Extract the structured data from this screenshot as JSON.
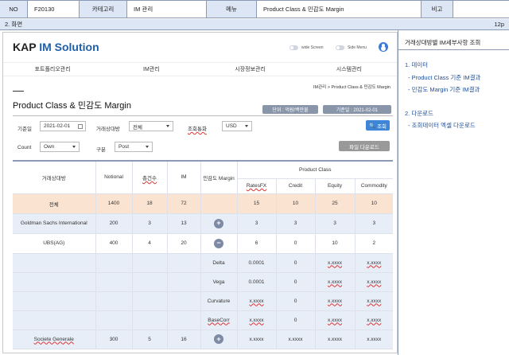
{
  "spec": {
    "no_label": "NO",
    "no_value": "F20130",
    "category_label": "카테고리",
    "category_value": "IM 관리",
    "menu_label": "메뉴",
    "menu_value": "Product Class & 민감도 Margin",
    "note_label": "비고",
    "note_value": ""
  },
  "section": {
    "title": "2. 화면",
    "page": "12p"
  },
  "app": {
    "logo_main": "KAP",
    "logo_accent": "IM Solution",
    "wide_screen_label": "wide Screen",
    "side_menu_label": "Side Menu",
    "nav": [
      "포트폴리오관리",
      "IM관리",
      "시장정보관리",
      "시스템관리"
    ],
    "breadcrumb": "IM관리 > Product Class & 민감도 Margin",
    "page_title": "Product Class & 민감도 Margin",
    "unit_pill": "단위 : 억원/백만불",
    "date_pill": "기준일 : 2021-02-01"
  },
  "filters": {
    "date_label": "기준일",
    "date_value": "2021-02-01",
    "counterparty_label": "거래상대방",
    "counterparty_value": "전체",
    "currency_label": "조회통화",
    "currency_value": "USD",
    "search_button": "조회",
    "count_label": "Count",
    "count_value": "Own",
    "type_label": "구분",
    "type_value": "Post",
    "download_button": "파일 다운로드"
  },
  "table": {
    "headers": {
      "counterparty": "거래상대방",
      "notional": "Notional",
      "count": "총건수",
      "im": "IM",
      "sensitivity_margin": "민감도 Margin",
      "product_class": "Product Class",
      "rates_fx": "RatesFX",
      "credit": "Credit",
      "equity": "Equity",
      "commodity": "Commodity"
    },
    "rows": [
      {
        "name": "전체",
        "notional": "1400",
        "count": "18",
        "im": "72",
        "sens": "",
        "rates_fx": "15",
        "credit": "10",
        "equity": "25",
        "commodity": "10"
      },
      {
        "name": "Goldman Sachs International",
        "notional": "200",
        "count": "3",
        "im": "13",
        "sens": "+",
        "rates_fx": "3",
        "credit": "3",
        "equity": "3",
        "commodity": "3"
      },
      {
        "name": "UBS(AG)",
        "notional": "400",
        "count": "4",
        "im": "20",
        "sens": "−",
        "rates_fx": "6",
        "credit": "0",
        "equity": "10",
        "commodity": "2"
      },
      {
        "name": "",
        "notional": "",
        "count": "",
        "im": "",
        "sens": "Delta",
        "rates_fx": "0.0001",
        "credit": "0",
        "equity": "x.xxxx",
        "commodity": "x.xxxx"
      },
      {
        "name": "",
        "notional": "",
        "count": "",
        "im": "",
        "sens": "Vega",
        "rates_fx": "0.0001",
        "credit": "0",
        "equity": "x.xxxx",
        "commodity": "x.xxxx"
      },
      {
        "name": "",
        "notional": "",
        "count": "",
        "im": "",
        "sens": "Curvature",
        "rates_fx": "x.xxxx",
        "credit": "0",
        "equity": "x.xxxx",
        "commodity": "x.xxxx"
      },
      {
        "name": "",
        "notional": "",
        "count": "",
        "im": "",
        "sens": "BaseCorr",
        "rates_fx": "x.xxxx",
        "credit": "0",
        "equity": "x.xxxx",
        "commodity": "x.xxxx"
      },
      {
        "name": "Societe Generale",
        "notional": "300",
        "count": "5",
        "im": "16",
        "sens": "+",
        "rates_fx": "x.xxxx",
        "credit": "x.xxxx",
        "equity": "x.xxxx",
        "commodity": "x.xxxx"
      }
    ]
  },
  "right_panel": {
    "title": "거래상대방별 IM세부사항 조회",
    "section1": "1. 데이터",
    "item1": "- Product Class 기준 IM결과",
    "item2": "- 민감도 Margin 기준 IM결과",
    "section2": "2. 다운로드",
    "item3": "- 조회데이터 엑셀 다운로드"
  },
  "colors": {
    "accent": "#1f5fa8",
    "header_bg": "#dce6f4",
    "total_row": "#fbe3d2",
    "blue_row": "#e8eef7"
  }
}
